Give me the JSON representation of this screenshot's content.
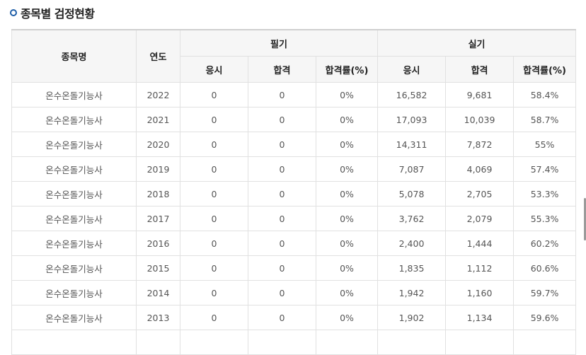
{
  "title": "종목별 검정현황",
  "headers": {
    "name": "종목명",
    "year": "연도",
    "written": "필기",
    "practical": "실기",
    "apply": "응시",
    "pass": "합격",
    "rate": "합격률(%)"
  },
  "rows": [
    {
      "name": "온수온돌기능사",
      "year": "2022",
      "w_apply": "0",
      "w_pass": "0",
      "w_rate": "0%",
      "p_apply": "16,582",
      "p_pass": "9,681",
      "p_rate": "58.4%"
    },
    {
      "name": "온수온돌기능사",
      "year": "2021",
      "w_apply": "0",
      "w_pass": "0",
      "w_rate": "0%",
      "p_apply": "17,093",
      "p_pass": "10,039",
      "p_rate": "58.7%"
    },
    {
      "name": "온수온돌기능사",
      "year": "2020",
      "w_apply": "0",
      "w_pass": "0",
      "w_rate": "0%",
      "p_apply": "14,311",
      "p_pass": "7,872",
      "p_rate": "55%"
    },
    {
      "name": "온수온돌기능사",
      "year": "2019",
      "w_apply": "0",
      "w_pass": "0",
      "w_rate": "0%",
      "p_apply": "7,087",
      "p_pass": "4,069",
      "p_rate": "57.4%"
    },
    {
      "name": "온수온돌기능사",
      "year": "2018",
      "w_apply": "0",
      "w_pass": "0",
      "w_rate": "0%",
      "p_apply": "5,078",
      "p_pass": "2,705",
      "p_rate": "53.3%"
    },
    {
      "name": "온수온돌기능사",
      "year": "2017",
      "w_apply": "0",
      "w_pass": "0",
      "w_rate": "0%",
      "p_apply": "3,762",
      "p_pass": "2,079",
      "p_rate": "55.3%"
    },
    {
      "name": "온수온돌기능사",
      "year": "2016",
      "w_apply": "0",
      "w_pass": "0",
      "w_rate": "0%",
      "p_apply": "2,400",
      "p_pass": "1,444",
      "p_rate": "60.2%"
    },
    {
      "name": "온수온돌기능사",
      "year": "2015",
      "w_apply": "0",
      "w_pass": "0",
      "w_rate": "0%",
      "p_apply": "1,835",
      "p_pass": "1,112",
      "p_rate": "60.6%"
    },
    {
      "name": "온수온돌기능사",
      "year": "2014",
      "w_apply": "0",
      "w_pass": "0",
      "w_rate": "0%",
      "p_apply": "1,942",
      "p_pass": "1,160",
      "p_rate": "59.7%"
    },
    {
      "name": "온수온돌기능사",
      "year": "2013",
      "w_apply": "0",
      "w_pass": "0",
      "w_rate": "0%",
      "p_apply": "1,902",
      "p_pass": "1,134",
      "p_rate": "59.6%"
    },
    {
      "name": "",
      "year": "",
      "w_apply": "",
      "w_pass": "",
      "w_rate": "",
      "p_apply": "",
      "p_pass": "",
      "p_rate": ""
    }
  ],
  "icons": {
    "title_bullet": "circle-bullet-icon"
  },
  "colors": {
    "accent": "#1e5ea8",
    "header_bg": "#f6f6f6",
    "border": "#e1e1e1"
  }
}
